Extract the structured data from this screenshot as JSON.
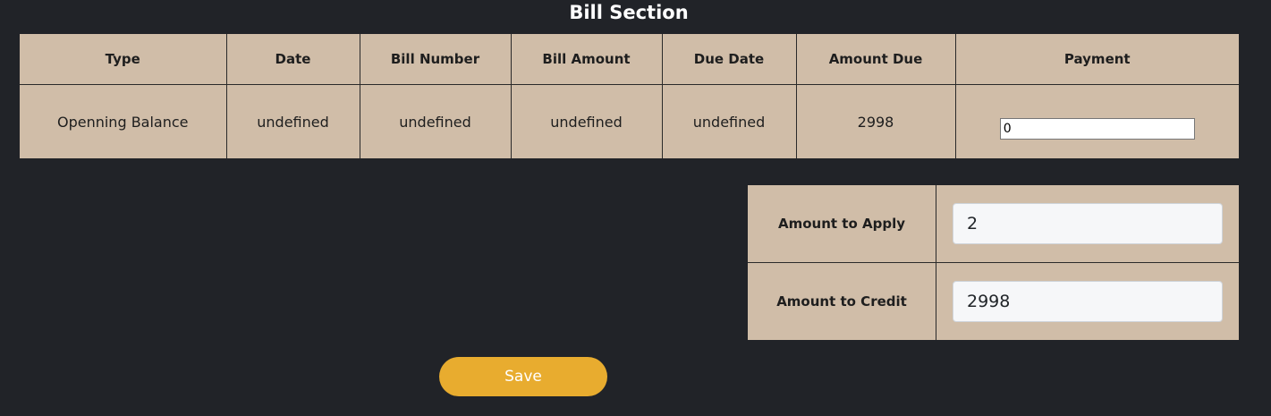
{
  "section": {
    "title": "Bill Section"
  },
  "bill_table": {
    "headers": [
      "Type",
      "Date",
      "Bill Number",
      "Bill Amount",
      "Due Date",
      "Amount Due",
      "Payment"
    ],
    "rows": [
      {
        "type": "Openning Balance",
        "date": "undefined",
        "bill_number": "undefined",
        "bill_amount": "undefined",
        "due_date": "undefined",
        "amount_due": "2998",
        "payment": "0"
      }
    ]
  },
  "amounts": {
    "apply_label": "Amount to Apply",
    "apply_value": "2",
    "credit_label": "Amount to Credit",
    "credit_value": "2998"
  },
  "actions": {
    "save_label": "Save"
  },
  "colors": {
    "background": "#212328",
    "table_background": "#d0bda8",
    "save_button": "#e8ac2f"
  }
}
